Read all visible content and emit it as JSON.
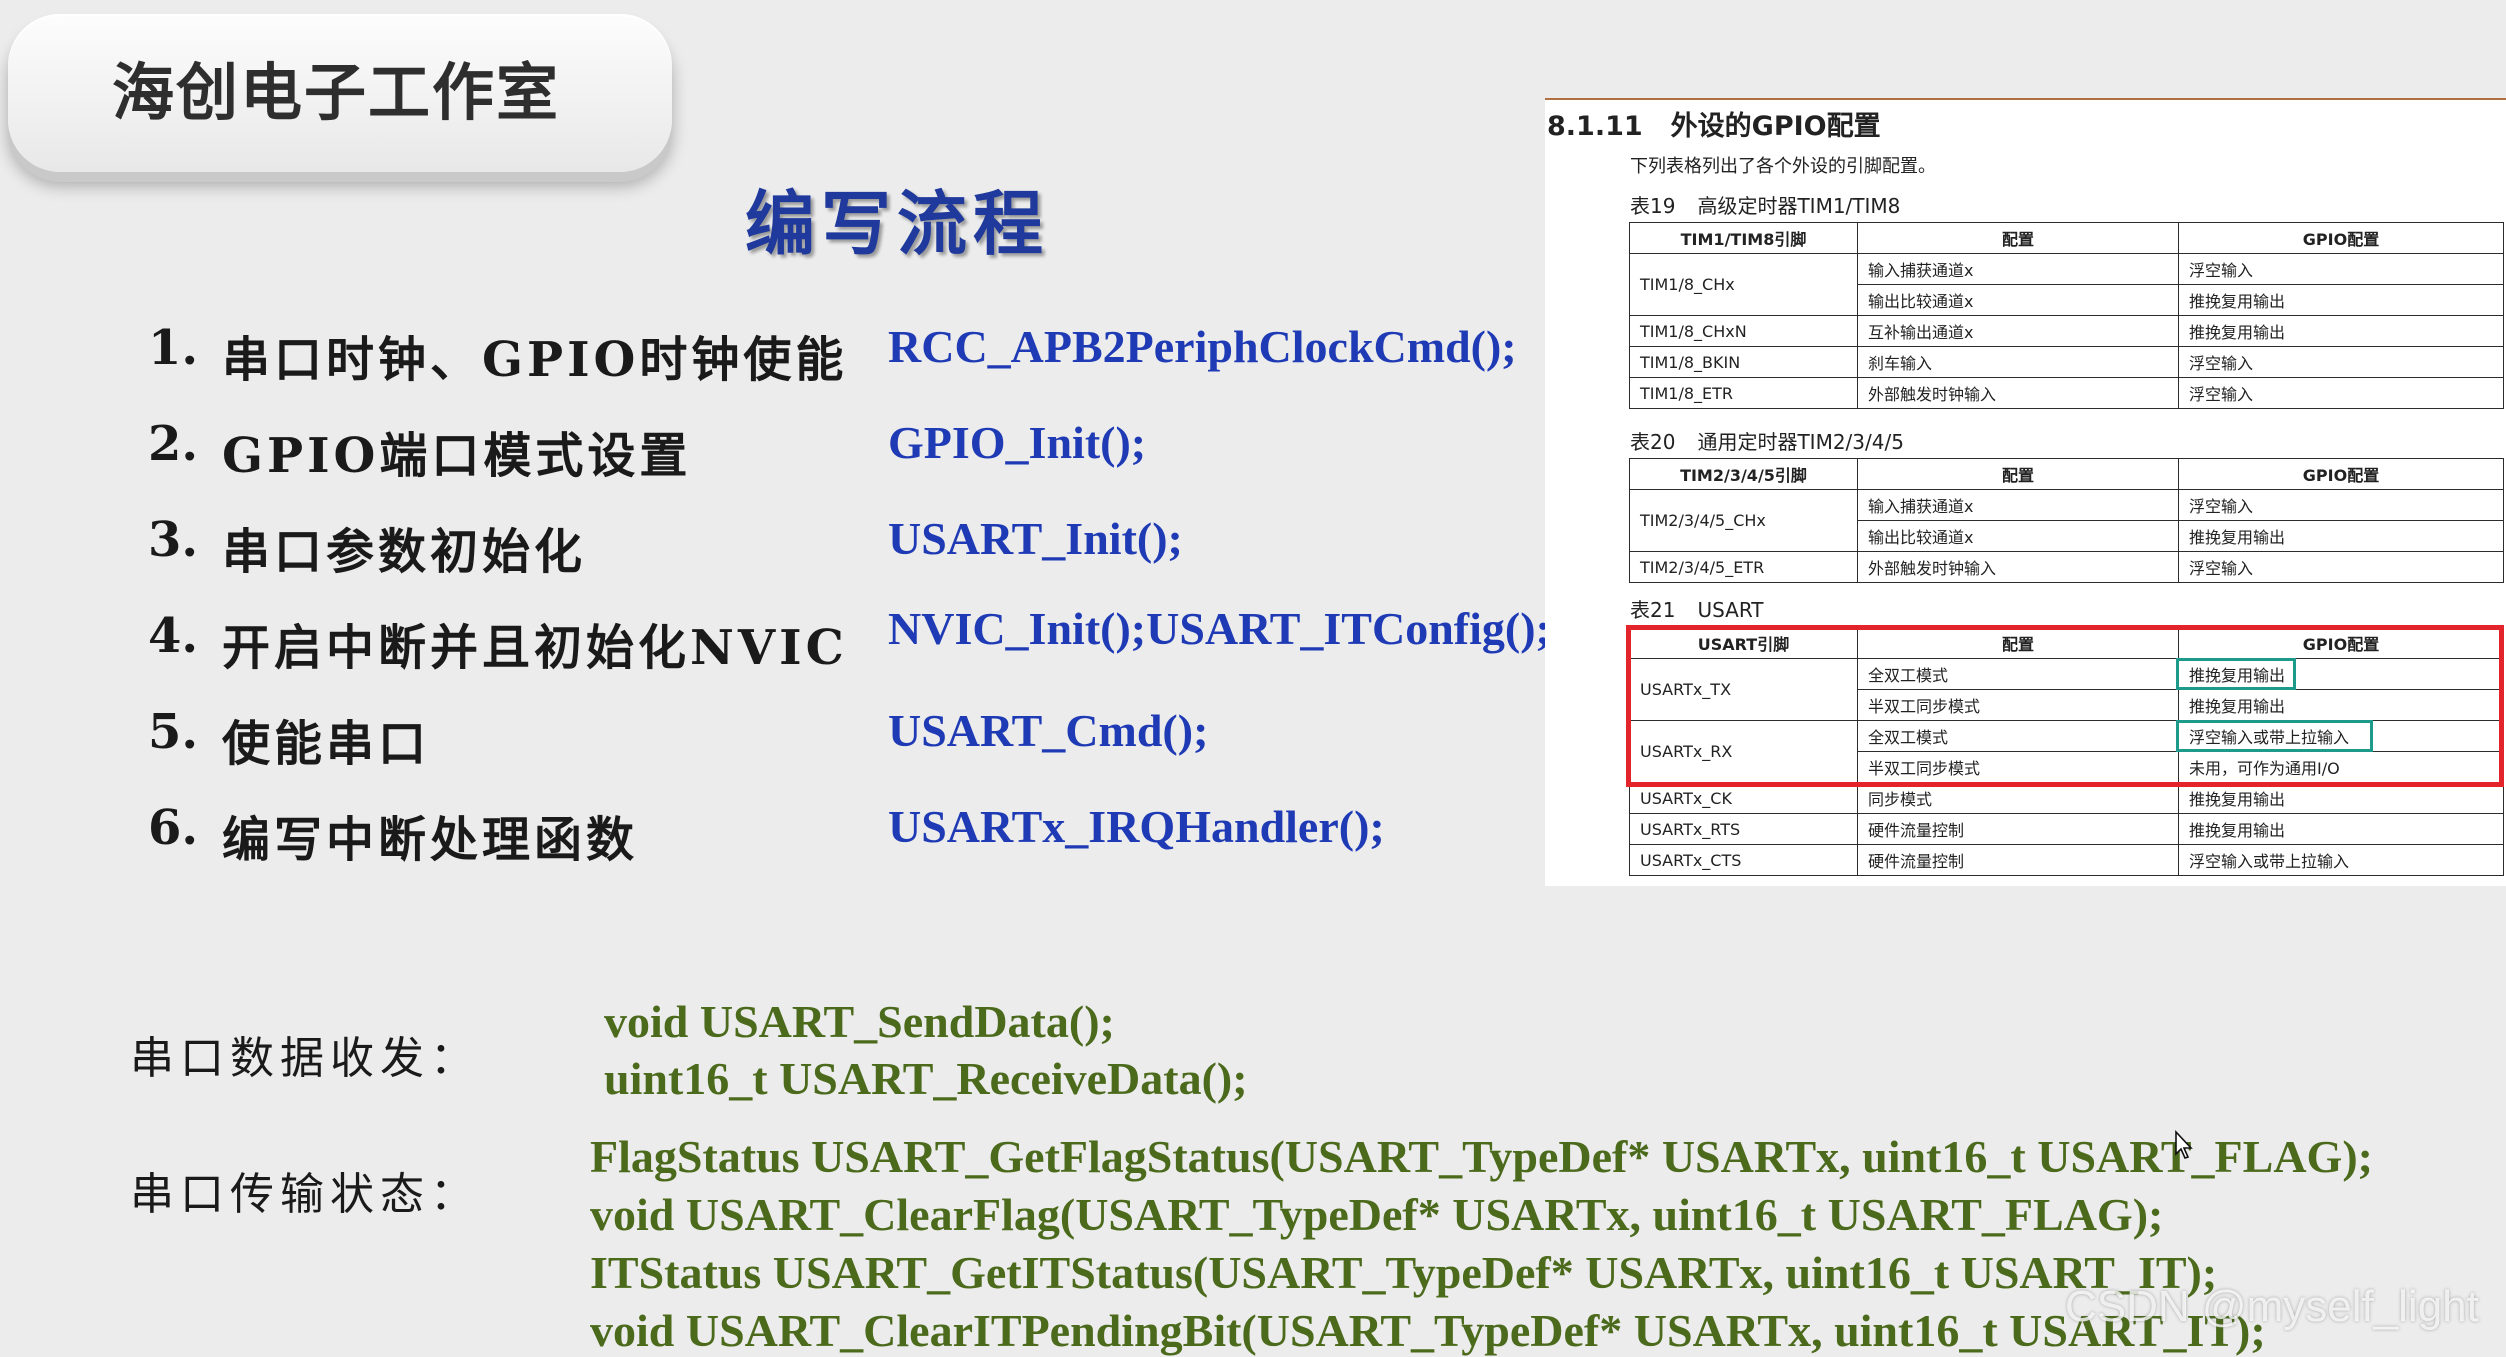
{
  "header": {
    "brand": "海创电子工作室",
    "title": "编写流程"
  },
  "steps": [
    {
      "num": "1.",
      "label": "串口时钟、GPIO时钟使能",
      "code": "RCC_APB2PeriphClockCmd();"
    },
    {
      "num": "2.",
      "label": "GPIO端口模式设置",
      "code": "GPIO_Init();"
    },
    {
      "num": "3.",
      "label": "串口参数初始化",
      "code": "USART_Init();"
    },
    {
      "num": "4.",
      "label": "开启中断并且初始化NVIC",
      "code": "NVIC_Init();USART_ITConfig();"
    },
    {
      "num": "5.",
      "label": "使能串口",
      "code": "USART_Cmd();"
    },
    {
      "num": "6.",
      "label": "编写中断处理函数",
      "code": "USARTx_IRQHandler();"
    }
  ],
  "data_io": {
    "label": "串口数据收发：",
    "lines": [
      "void USART_SendData();",
      "uint16_t USART_ReceiveData();"
    ]
  },
  "status": {
    "label": "串口传输状态：",
    "lines": [
      "FlagStatus USART_GetFlagStatus(USART_TypeDef* USARTx, uint16_t USART_FLAG);",
      "void USART_ClearFlag(USART_TypeDef* USARTx, uint16_t USART_FLAG);",
      "ITStatus USART_GetITStatus(USART_TypeDef* USARTx, uint16_t USART_IT);",
      "void USART_ClearITPendingBit(USART_TypeDef* USARTx, uint16_t USART_IT);"
    ]
  },
  "reference": {
    "section_num": "8.1.11",
    "section_title": "外设的GPIO配置",
    "intro": "下列表格列出了各个外设的引脚配置。",
    "tables": [
      {
        "cap_num": "表19",
        "cap_name": "高级定时器TIM1/TIM8",
        "headers": [
          "TIM1/TIM8引脚",
          "配置",
          "GPIO配置"
        ],
        "rows": [
          {
            "pin": "TIM1/8_CHx",
            "cfg": [
              "输入捕获通道x",
              "输出比较通道x"
            ],
            "gpio": [
              "浮空输入",
              "推挽复用输出"
            ]
          },
          {
            "pin": "TIM1/8_CHxN",
            "cfg": [
              "互补输出通道x"
            ],
            "gpio": [
              "推挽复用输出"
            ]
          },
          {
            "pin": "TIM1/8_BKIN",
            "cfg": [
              "刹车输入"
            ],
            "gpio": [
              "浮空输入"
            ]
          },
          {
            "pin": "TIM1/8_ETR",
            "cfg": [
              "外部触发时钟输入"
            ],
            "gpio": [
              "浮空输入"
            ]
          }
        ]
      },
      {
        "cap_num": "表20",
        "cap_name": "通用定时器TIM2/3/4/5",
        "headers": [
          "TIM2/3/4/5引脚",
          "配置",
          "GPIO配置"
        ],
        "rows": [
          {
            "pin": "TIM2/3/4/5_CHx",
            "cfg": [
              "输入捕获通道x",
              "输出比较通道x"
            ],
            "gpio": [
              "浮空输入",
              "推挽复用输出"
            ]
          },
          {
            "pin": "TIM2/3/4/5_ETR",
            "cfg": [
              "外部触发时钟输入"
            ],
            "gpio": [
              "浮空输入"
            ]
          }
        ]
      },
      {
        "cap_num": "表21",
        "cap_name": "USART",
        "headers": [
          "USART引脚",
          "配置",
          "GPIO配置"
        ],
        "rows": [
          {
            "pin": "USARTx_TX",
            "cfg": [
              "全双工模式",
              "半双工同步模式"
            ],
            "gpio": [
              "推挽复用输出",
              "推挽复用输出"
            ]
          },
          {
            "pin": "USARTx_RX",
            "cfg": [
              "全双工模式",
              "半双工同步模式"
            ],
            "gpio": [
              "浮空输入或带上拉输入",
              "未用，可作为通用I/O"
            ]
          },
          {
            "pin": "USARTx_CK",
            "cfg": [
              "同步模式"
            ],
            "gpio": [
              "推挽复用输出"
            ]
          },
          {
            "pin": "USARTx_RTS",
            "cfg": [
              "硬件流量控制"
            ],
            "gpio": [
              "推挽复用输出"
            ]
          },
          {
            "pin": "USARTx_CTS",
            "cfg": [
              "硬件流量控制"
            ],
            "gpio": [
              "浮空输入或带上拉输入"
            ]
          }
        ]
      }
    ]
  },
  "watermark": "CSDN @myself_light"
}
